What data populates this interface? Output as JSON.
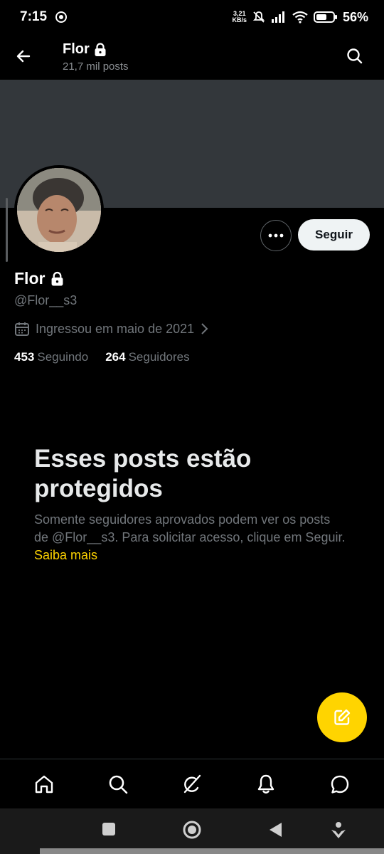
{
  "status_bar": {
    "time": "7:15",
    "net_speed_value": "3,21",
    "net_speed_unit": "KB/s",
    "battery_percent": "56%"
  },
  "header": {
    "name": "Flor",
    "post_count": "21,7 mil posts"
  },
  "profile": {
    "name": "Flor",
    "handle": "@Flor__s3",
    "joined": "Ingressou em maio de 2021",
    "following_count": "453",
    "following_label": "Seguindo",
    "followers_count": "264",
    "followers_label": "Seguidores",
    "follow_button": "Seguir"
  },
  "protected_notice": {
    "title": "Esses posts estão protegidos",
    "body": "Somente seguidores aprovados podem ver os posts de @Flor__s3. Para solicitar acesso, clique em Seguir.",
    "learn_more": "Saiba mais"
  },
  "colors": {
    "accent": "#ffd400",
    "background": "#000000",
    "banner": "#33373b",
    "secondary_text": "#71767b"
  },
  "icons": {
    "back": "arrow-left-icon",
    "search": "search-icon",
    "lock": "lock-icon",
    "more": "more-horizontal-icon",
    "calendar": "calendar-icon",
    "compose": "compose-icon",
    "nav": [
      "home-icon",
      "search-icon",
      "grok-icon",
      "notifications-icon",
      "messages-icon"
    ]
  }
}
